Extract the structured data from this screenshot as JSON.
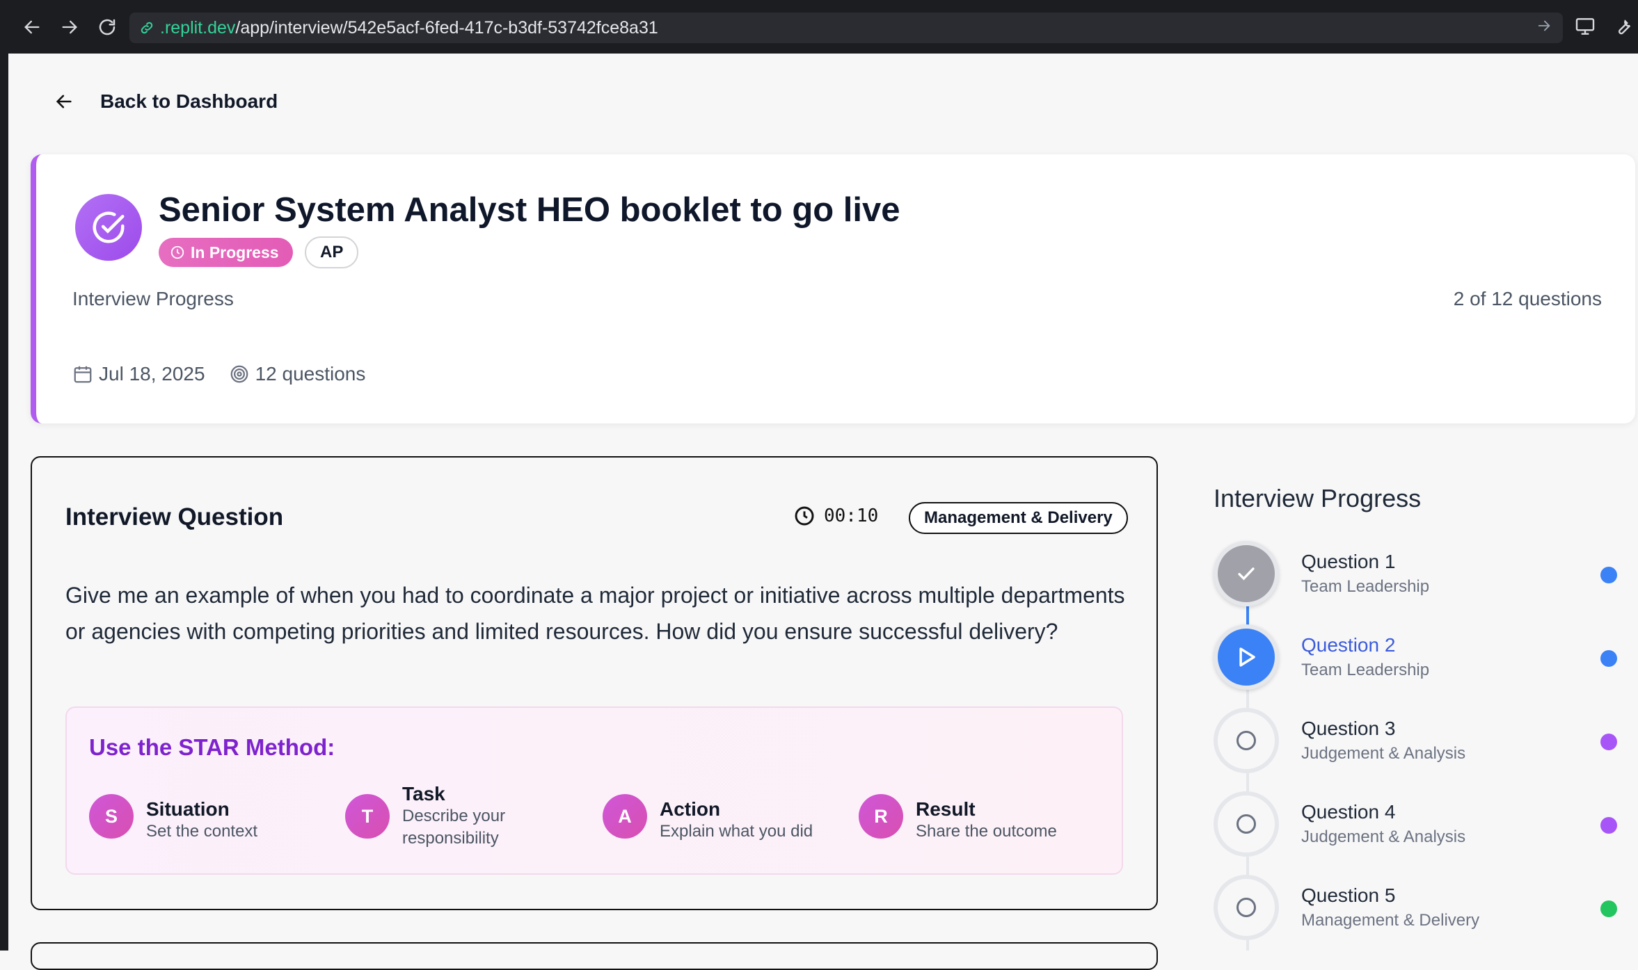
{
  "browser": {
    "url_host": ".replit.dev",
    "url_path": "/app/interview/542e5acf-6fed-417c-b3df-53742fce8a31"
  },
  "back_link": {
    "label": "Back to Dashboard"
  },
  "header": {
    "title": "Senior System Analyst HEO booklet to go live",
    "status_badge": "In Progress",
    "initials_badge": "AP",
    "progress_label": "Interview Progress",
    "progress_count": "2 of 12 questions",
    "date": "Jul 18, 2025",
    "question_total": "12 questions",
    "accent_color": "#b05cf0"
  },
  "question": {
    "heading": "Interview Question",
    "timer": "00:10",
    "category": "Management & Delivery",
    "text": "Give me an example of when you had to coordinate a major project or initiative across multiple departments or agencies with competing priorities and limited resources. How did you ensure successful delivery?",
    "star": {
      "title": "Use the STAR Method:",
      "items": [
        {
          "letter": "S",
          "title": "Situation",
          "desc": "Set the context"
        },
        {
          "letter": "T",
          "title": "Task",
          "desc": "Describe your responsibility"
        },
        {
          "letter": "A",
          "title": "Action",
          "desc": "Explain what you did"
        },
        {
          "letter": "R",
          "title": "Result",
          "desc": "Share the outcome"
        }
      ]
    }
  },
  "sidebar": {
    "title": "Interview Progress",
    "steps": [
      {
        "label": "Question 1",
        "category": "Team Leadership",
        "state": "done",
        "dot_color": "#3b82f6"
      },
      {
        "label": "Question 2",
        "category": "Team Leadership",
        "state": "current",
        "dot_color": "#3b82f6"
      },
      {
        "label": "Question 3",
        "category": "Judgement & Analysis",
        "state": "todo",
        "dot_color": "#a855f7"
      },
      {
        "label": "Question 4",
        "category": "Judgement & Analysis",
        "state": "todo",
        "dot_color": "#a855f7"
      },
      {
        "label": "Question 5",
        "category": "Management & Delivery",
        "state": "todo",
        "dot_color": "#22c55e"
      }
    ]
  }
}
